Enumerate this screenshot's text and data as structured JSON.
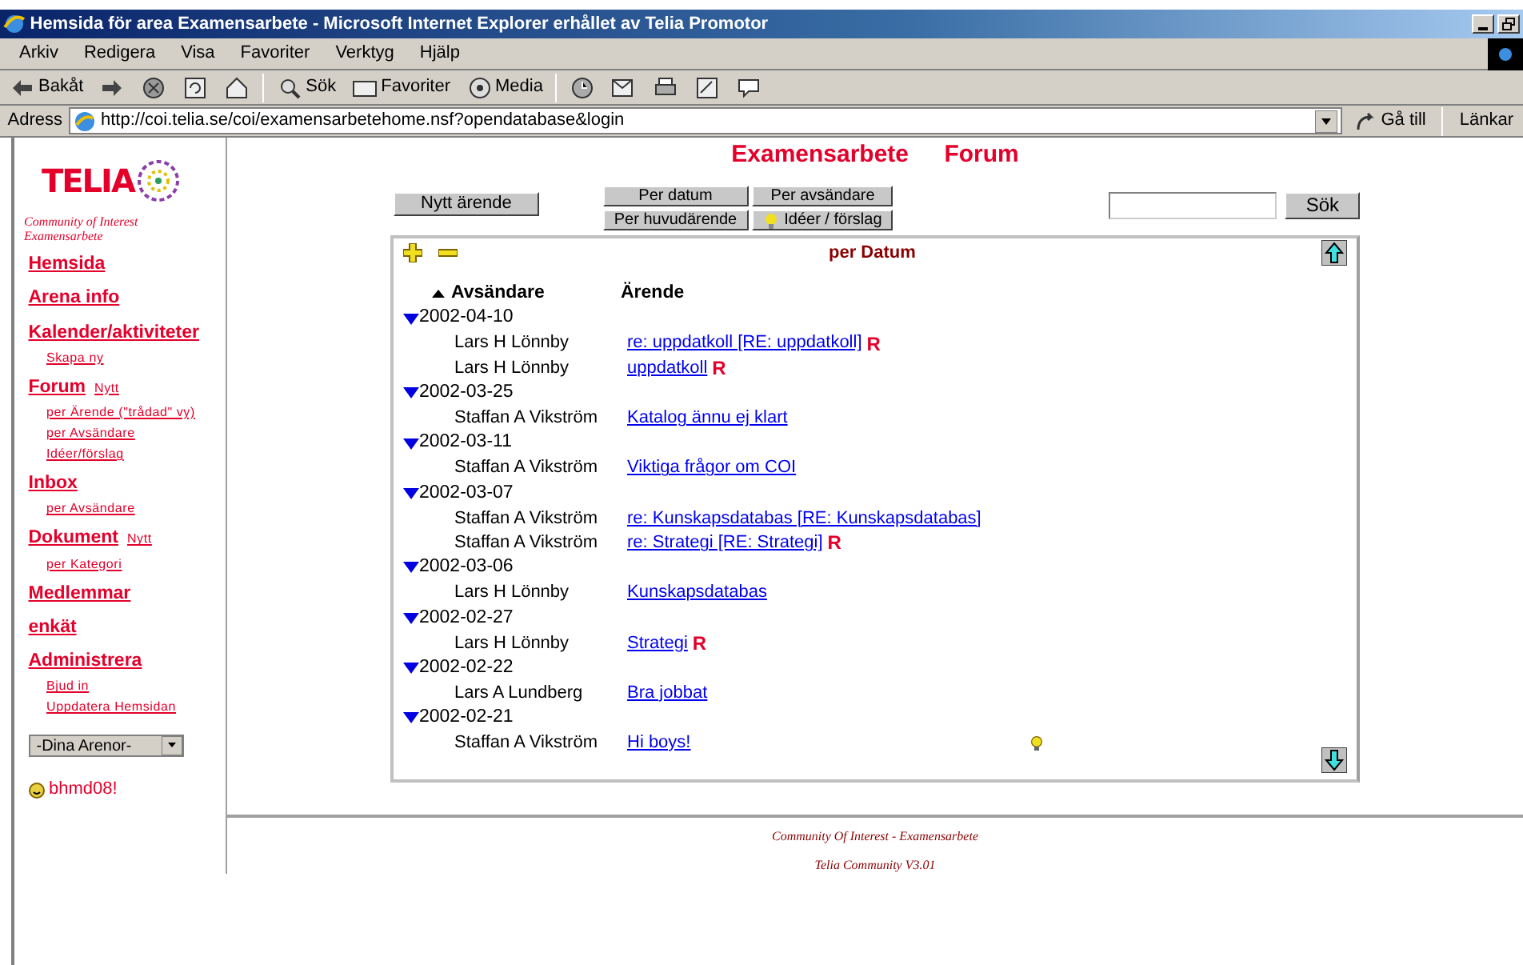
{
  "window": {
    "title": "Hemsida för area Examensarbete - Microsoft Internet Explorer erhållet av Telia Promotor"
  },
  "menu": [
    "Arkiv",
    "Redigera",
    "Visa",
    "Favoriter",
    "Verktyg",
    "Hjälp"
  ],
  "toolbar": [
    {
      "kind": "back",
      "label": "Bakåt"
    },
    {
      "kind": "forward"
    },
    {
      "kind": "stop"
    },
    {
      "kind": "refresh"
    },
    {
      "kind": "home"
    },
    {
      "kind": "search",
      "label": "Sök"
    },
    {
      "kind": "favorites",
      "label": "Favoriter"
    },
    {
      "kind": "media",
      "label": "Media"
    },
    {
      "kind": "history"
    },
    {
      "kind": "mail"
    },
    {
      "kind": "print"
    },
    {
      "kind": "edit"
    },
    {
      "kind": "discuss"
    }
  ],
  "address": {
    "label": "Adress",
    "url": "http://coi.telia.se/coi/examensarbetehome.nsf?opendatabase&login",
    "go": "Gå till",
    "links": "Länkar"
  },
  "sidebar": {
    "brand": "TELIA",
    "caption": [
      "Community of Interest",
      "Examensarbete"
    ],
    "nav": [
      {
        "label": "Hemsida"
      },
      {
        "label": "Arena info"
      },
      {
        "label": "Kalender/aktiviteter",
        "children": [
          "Skapa ny"
        ]
      },
      {
        "label": "Forum",
        "extra": "Nytt",
        "children": [
          "per Ärende (\"trådad\" vy)",
          "per Avsändare",
          "Idéer/förslag"
        ]
      },
      {
        "label": "Inbox",
        "children": [
          "per Avsändare"
        ]
      },
      {
        "label": "Dokument",
        "extra": "Nytt",
        "children": [
          "per Kategori"
        ]
      },
      {
        "label": "Medlemmar"
      },
      {
        "label": "enkät"
      },
      {
        "label": "Administrera",
        "children": [
          "Bjud in",
          "Uppdatera Hemsidan"
        ]
      }
    ],
    "arena_select": "-Dina Arenor-",
    "user": "bhmd08!"
  },
  "page": {
    "heading": [
      "Examensarbete",
      "Forum"
    ],
    "new_button": "Nytt ärende",
    "view_buttons": [
      {
        "label": "Per datum",
        "kind": "plain"
      },
      {
        "label": "Per avsändare",
        "kind": "plain"
      },
      {
        "label": "Per huvudärende",
        "kind": "plain"
      },
      {
        "label": "Idéer / förslag",
        "kind": "ideas"
      }
    ],
    "search_button": "Sök"
  },
  "forum": {
    "title": "per Datum",
    "columns": [
      "Avsändare",
      "Ärende"
    ],
    "groups": [
      {
        "date": "2002-04-10",
        "expanded": true,
        "posts": [
          {
            "sender": "Lars H Lönnby",
            "subject": "re: uppdatkoll [RE: uppdatkoll]",
            "mark": "R",
            "idea": false
          },
          {
            "sender": "Lars H Lönnby",
            "subject": "uppdatkoll",
            "mark": "R",
            "idea": false
          }
        ]
      },
      {
        "date": "2002-03-25",
        "expanded": true,
        "posts": [
          {
            "sender": "Staffan A Vikström",
            "subject": "Katalog ännu ej klart",
            "idea": false
          }
        ]
      },
      {
        "date": "2002-03-11",
        "expanded": true,
        "posts": [
          {
            "sender": "Staffan A Vikström",
            "subject": "Viktiga frågor om COI",
            "idea": false
          }
        ]
      },
      {
        "date": "2002-03-07",
        "expanded": true,
        "posts": [
          {
            "sender": "Staffan A Vikström",
            "subject": "re: Kunskapsdatabas [RE: Kunskapsdatabas]",
            "idea": false
          },
          {
            "sender": "Staffan A Vikström",
            "subject": "re: Strategi [RE: Strategi]",
            "mark": "R",
            "idea": false
          }
        ]
      },
      {
        "date": "2002-03-06",
        "expanded": true,
        "posts": [
          {
            "sender": "Lars H Lönnby",
            "subject": "Kunskapsdatabas",
            "idea": false
          }
        ]
      },
      {
        "date": "2002-02-27",
        "expanded": true,
        "posts": [
          {
            "sender": "Lars H Lönnby",
            "subject": "Strategi",
            "mark": "R",
            "idea": false
          }
        ]
      },
      {
        "date": "2002-02-22",
        "expanded": true,
        "posts": [
          {
            "sender": "Lars A Lundberg",
            "subject": "Bra jobbat",
            "idea": false
          }
        ]
      },
      {
        "date": "2002-02-21",
        "expanded": true,
        "posts": [
          {
            "sender": "Staffan A Vikström",
            "subject": "Hi boys!",
            "idea": true
          }
        ]
      }
    ]
  },
  "footer": [
    "Community Of Interest - Examensarbete",
    "Telia Community V3.01"
  ]
}
